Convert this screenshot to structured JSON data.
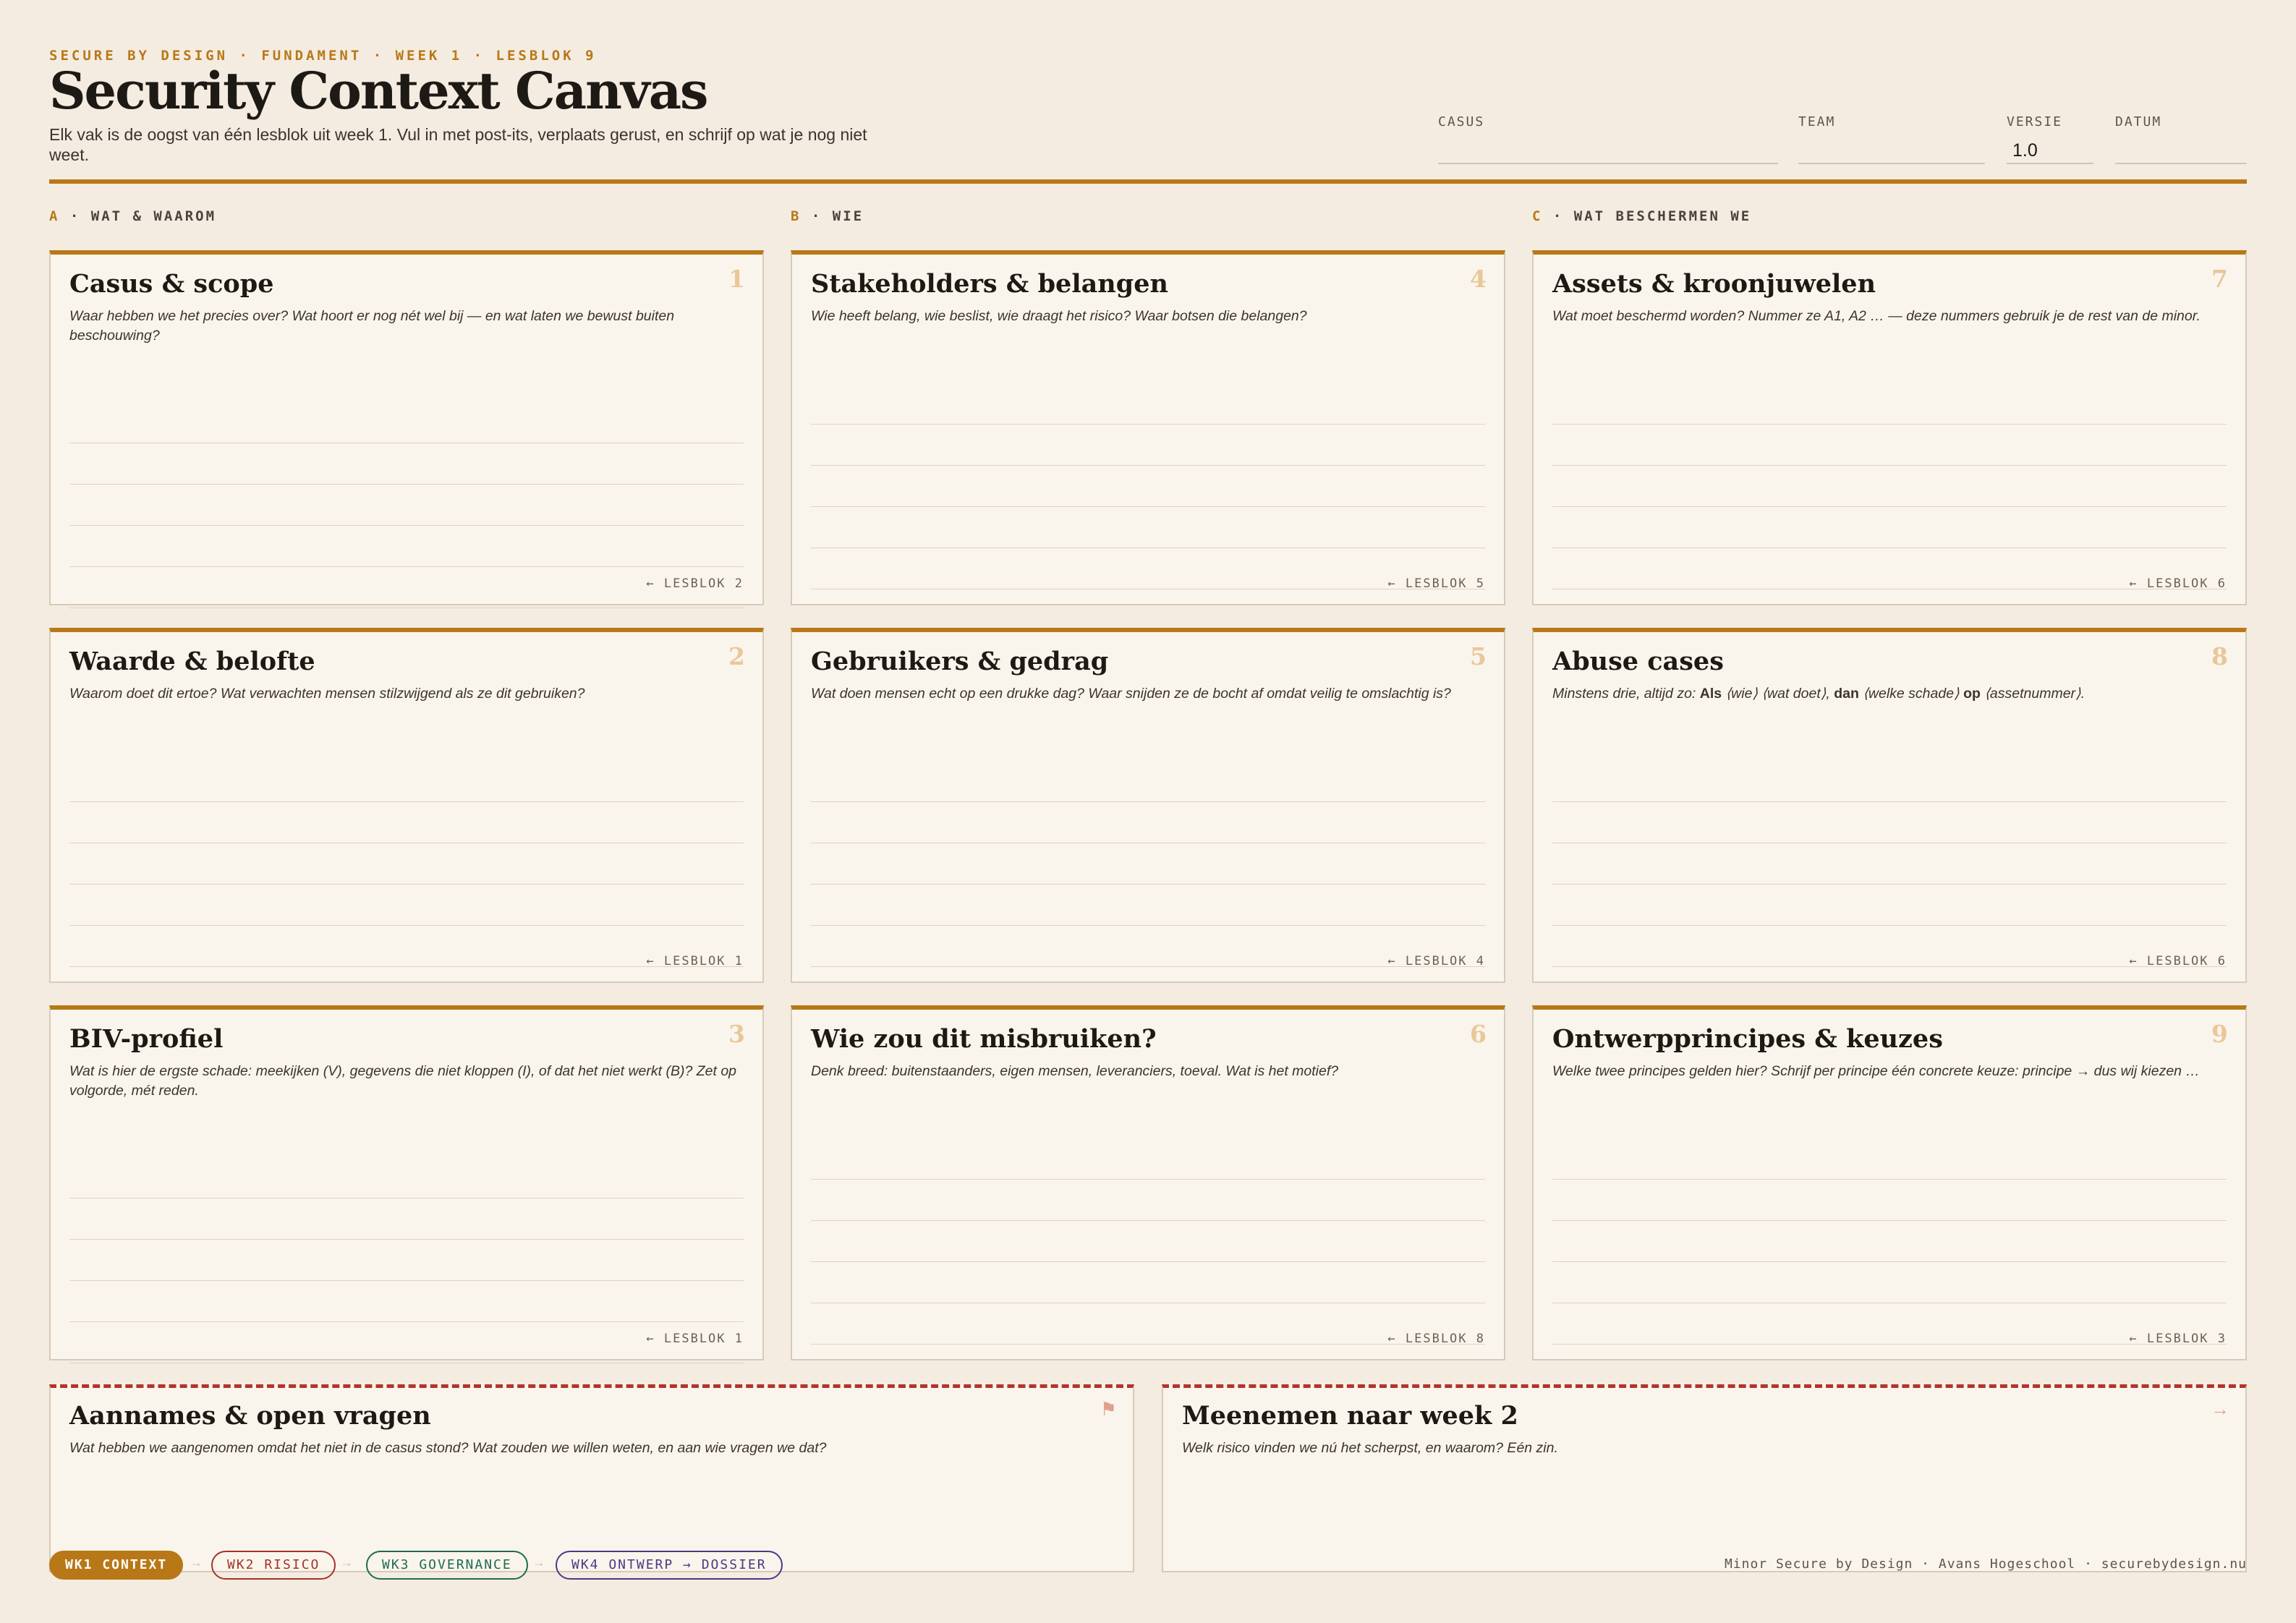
{
  "header": {
    "eyebrow": "SECURE BY DESIGN · FUNDAMENT · WEEK 1 · LESBLOK 9",
    "title": "Security Context Canvas",
    "subtitle": "Elk vak is de oogst van één lesblok uit week 1. Vul in met post-its, verplaats gerust, en schrijf op wat je nog niet weet.",
    "fields": {
      "casus": {
        "label": "CASUS",
        "value": ""
      },
      "team": {
        "label": "TEAM",
        "value": ""
      },
      "versie": {
        "label": "VERSIE",
        "value": "1.0"
      },
      "datum": {
        "label": "DATUM",
        "value": ""
      }
    }
  },
  "columns": [
    {
      "letter": "A",
      "label": "· WAT & WAAROM"
    },
    {
      "letter": "B",
      "label": "· WIE"
    },
    {
      "letter": "C",
      "label": "· WAT BESCHERMEN WE"
    }
  ],
  "cards": [
    {
      "number": "1",
      "title": "Casus & scope",
      "prompt": "Waar hebben we het precies over? Wat hoort er nog nét wel bij — en wat laten we bewust buiten beschouwing?",
      "ref": "← LESBLOK 2"
    },
    {
      "number": "4",
      "title": "Stakeholders & belangen",
      "prompt": "Wie heeft belang, wie beslist, wie draagt het risico? Waar botsen die belangen?",
      "ref": "← LESBLOK 5"
    },
    {
      "number": "7",
      "title": "Assets & kroonjuwelen",
      "prompt": "Wat moet beschermd worden? Nummer ze A1, A2 … — deze nummers gebruik je de rest van de minor.",
      "ref": "← LESBLOK 6"
    },
    {
      "number": "2",
      "title": "Waarde & belofte",
      "prompt": "Waarom doet dit ertoe? Wat verwachten mensen stilzwijgend als ze dit gebruiken?",
      "ref": "← LESBLOK 1"
    },
    {
      "number": "5",
      "title": "Gebruikers & gedrag",
      "prompt": "Wat doen mensen echt op een drukke dag? Waar snijden ze de bocht af omdat veilig te omslachtig is?",
      "ref": "← LESBLOK 4"
    },
    {
      "number": "8",
      "title": "Abuse cases",
      "prompt_parts": [
        "Minstens drie, altijd zo: ",
        "Als",
        " ⟨wie⟩ ⟨wat doet⟩, ",
        "dan",
        " ⟨welke schade⟩ ",
        "op",
        " ⟨assetnummer⟩."
      ],
      "ref": "← LESBLOK 6"
    },
    {
      "number": "3",
      "title": "BIV-profiel",
      "prompt": "Wat is hier de ergste schade: meekijken (V), gegevens die niet kloppen (I), of dat het niet werkt (B)? Zet op volgorde, mét reden.",
      "ref": "← LESBLOK 1"
    },
    {
      "number": "6",
      "title": "Wie zou dit misbruiken?",
      "prompt": "Denk breed: buitenstaanders, eigen mensen, leveranciers, toeval. Wat is het motief?",
      "ref": "← LESBLOK 8"
    },
    {
      "number": "9",
      "title": "Ontwerpprincipes & keuzes",
      "prompt": "Welke twee principes gelden hier? Schrijf per principe één concrete keuze: principe → dus wij kiezen …",
      "ref": "← LESBLOK 3"
    }
  ],
  "bottom": [
    {
      "title": "Aannames & open vragen",
      "prompt": "Wat hebben we aangenomen omdat het niet in de casus stond? Wat zouden we willen weten, en aan wie vragen we dat?",
      "icon": "flag-icon",
      "glyph": "⚑"
    },
    {
      "title": "Meenemen naar week 2",
      "prompt": "Welk risico vinden we nú het scherpst, en waarom? Eén zin.",
      "icon": "arrow-right-icon",
      "glyph": "→"
    }
  ],
  "footer": {
    "steps": [
      "WK1 CONTEXT",
      "WK2 RISICO",
      "WK3 GOVERNANCE",
      "WK4 ONTWERP → DOSSIER"
    ],
    "separator": "→",
    "credits": "Minor Secure by Design · Avans Hogeschool · securebydesign.nu"
  },
  "colors": {
    "accent": "#b87818",
    "background": "#f4ece0",
    "card": "#faf5ec",
    "dashed_border": "#b3342c",
    "week2": "#a3332b",
    "week3": "#1f6b52",
    "week4": "#4a3a86"
  }
}
